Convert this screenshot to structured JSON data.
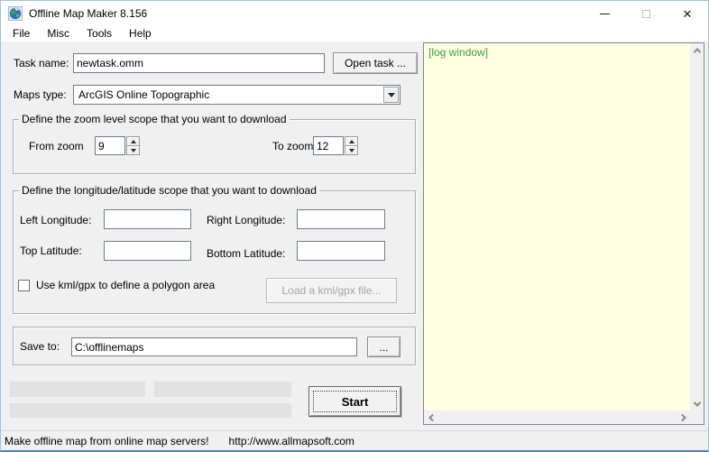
{
  "window": {
    "title": "Offline Map Maker 8.156",
    "controls": {
      "minimize": "minimize",
      "maximize": "maximize",
      "close": "✕"
    }
  },
  "menu": {
    "items": [
      "File",
      "Misc",
      "Tools",
      "Help"
    ]
  },
  "form": {
    "task_name": {
      "label": "Task name:",
      "value": "newtask.omm",
      "open_task_button": "Open task ..."
    },
    "maps_type": {
      "label": "Maps type:",
      "selected": "ArcGIS Online Topographic"
    },
    "zoom_group": {
      "legend": "Define the zoom level scope that you want to download",
      "from_label": "From zoom",
      "from_value": "9",
      "to_label": "To zoom",
      "to_value": "12"
    },
    "area_group": {
      "legend": "Define the longitude/latitude scope that you want to download",
      "left_longitude_label": "Left Longitude:",
      "left_longitude_value": "",
      "right_longitude_label": "Right Longitude:",
      "right_longitude_value": "",
      "top_latitude_label": "Top Latitude:",
      "top_latitude_value": "",
      "bottom_latitude_label": "Bottom Latitude:",
      "bottom_latitude_value": "",
      "kml_checkbox_label": "Use kml/gpx to define a polygon area",
      "kml_checkbox_checked": false,
      "load_kml_button": "Load a kml/gpx file..."
    },
    "save_group": {
      "label": "Save to:",
      "value": "C:\\offlinemaps",
      "browse_button": "..."
    },
    "start_button": "Start"
  },
  "log": {
    "text": "[log window]"
  },
  "status_bar": {
    "message": "Make offline map from online map servers!",
    "url": "http://www.allmapsoft.com"
  },
  "colors": {
    "log_background": "#ffffe1",
    "log_text": "#3aa33a",
    "window_border": "#9cc3e0",
    "client_background": "#f0f0f0"
  }
}
